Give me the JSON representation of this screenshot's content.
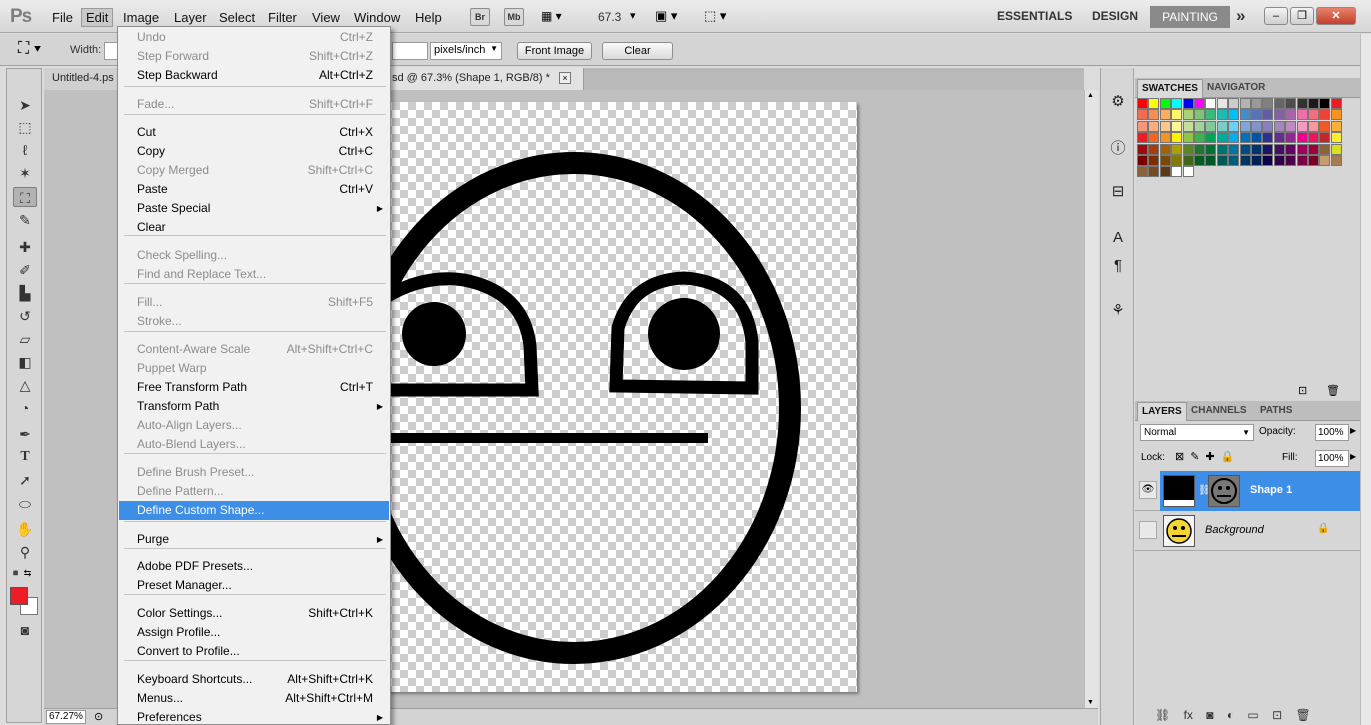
{
  "app": {
    "logo": "Ps"
  },
  "menubar": {
    "items": [
      "File",
      "Edit",
      "Image",
      "Layer",
      "Select",
      "Filter",
      "View",
      "Window",
      "Help"
    ],
    "bridge_btn": "Br",
    "minibridge_btn": "Mb",
    "zoom": "67.3",
    "workspaces": {
      "essentials": "ESSENTIALS",
      "design": "DESIGN",
      "painting": "PAINTING",
      "more": "»"
    }
  },
  "options": {
    "width_label": "Width:",
    "resolution_unit": "pixels/inch",
    "front_image": "Front Image",
    "clear": "Clear"
  },
  "tabs": {
    "tab1": "Untitled-4.ps",
    "tab2": "sd @ 67.3% (Shape 1, RGB/8) *",
    "close": "×"
  },
  "status": {
    "zoom": "67.27%"
  },
  "swatches_panel": {
    "tab_swatches": "SWATCHES",
    "tab_navigator": "NAVIGATOR",
    "colors": [
      "#ff0000",
      "#ffff00",
      "#00ff00",
      "#00ffff",
      "#0000ff",
      "#ff00ff",
      "#ffffff",
      "#e6e6e6",
      "#cccccc",
      "#b3b3b3",
      "#999999",
      "#808080",
      "#666666",
      "#4d4d4d",
      "#333333",
      "#1a1a1a",
      "#000000",
      "#ed1c24",
      "#f26c4f",
      "#f68e56",
      "#fbaf5d",
      "#fff568",
      "#acd373",
      "#7cc576",
      "#3cb878",
      "#1cbbb4",
      "#00bff3",
      "#448ccb",
      "#5574b9",
      "#605ca8",
      "#8560a8",
      "#a864a8",
      "#f06ea9",
      "#f26d7d",
      "#ef4136",
      "#f7941d",
      "#f7977a",
      "#f9ad81",
      "#fdc68a",
      "#fff79a",
      "#c4df9b",
      "#a3d39c",
      "#82ca9c",
      "#7accc8",
      "#6dcff6",
      "#7da7d9",
      "#8393ca",
      "#8781bd",
      "#a187be",
      "#bd8cbf",
      "#f49ac2",
      "#f6989d",
      "#f15a24",
      "#fbb03b",
      "#ed1c24",
      "#f26522",
      "#f7941d",
      "#fff200",
      "#8dc63f",
      "#39b54a",
      "#00a651",
      "#00a99d",
      "#00aeef",
      "#0072bc",
      "#0054a6",
      "#2e3192",
      "#662d91",
      "#92278f",
      "#ec008c",
      "#ed145b",
      "#c1272d",
      "#f9ed32",
      "#9e0b0f",
      "#a0410d",
      "#a36209",
      "#aba000",
      "#598527",
      "#1a7b30",
      "#007236",
      "#00746b",
      "#0076a3",
      "#004b80",
      "#003471",
      "#1b1464",
      "#440e62",
      "#630460",
      "#9e005d",
      "#9e0039",
      "#8c6239",
      "#d9e021",
      "#790000",
      "#7b2e00",
      "#7d4900",
      "#827b00",
      "#406618",
      "#005e20",
      "#005826",
      "#005952",
      "#005b7f",
      "#003663",
      "#002157",
      "#0d004c",
      "#32004b",
      "#4b0049",
      "#7b0046",
      "#7a0026",
      "#c69c6d",
      "#a67c52",
      "#8c6239",
      "#754c24",
      "#603913",
      "#ffffff",
      "#ffffff"
    ]
  },
  "layers_panel": {
    "tab_layers": "LAYERS",
    "tab_channels": "CHANNELS",
    "tab_paths": "PATHS",
    "blend_mode": "Normal",
    "opacity_label": "Opacity:",
    "opacity": "100%",
    "lock_label": "Lock:",
    "fill_label": "Fill:",
    "fill": "100%",
    "layers": [
      {
        "name": "Shape 1"
      },
      {
        "name": "Background"
      }
    ]
  },
  "edit_menu": {
    "items": [
      {
        "label": "Undo",
        "shortcut": "Ctrl+Z",
        "disabled": true
      },
      {
        "label": "Step Forward",
        "shortcut": "Shift+Ctrl+Z",
        "disabled": true
      },
      {
        "label": "Step Backward",
        "shortcut": "Alt+Ctrl+Z"
      },
      {
        "label": "Fade...",
        "shortcut": "Shift+Ctrl+F",
        "disabled": true
      },
      {
        "label": "Cut",
        "shortcut": "Ctrl+X"
      },
      {
        "label": "Copy",
        "shortcut": "Ctrl+C"
      },
      {
        "label": "Copy Merged",
        "shortcut": "Shift+Ctrl+C",
        "disabled": true
      },
      {
        "label": "Paste",
        "shortcut": "Ctrl+V"
      },
      {
        "label": "Paste Special",
        "submenu": true
      },
      {
        "label": "Clear"
      },
      {
        "label": "Check Spelling...",
        "disabled": true
      },
      {
        "label": "Find and Replace Text...",
        "disabled": true
      },
      {
        "label": "Fill...",
        "shortcut": "Shift+F5",
        "disabled": true
      },
      {
        "label": "Stroke...",
        "disabled": true
      },
      {
        "label": "Content-Aware Scale",
        "shortcut": "Alt+Shift+Ctrl+C",
        "disabled": true
      },
      {
        "label": "Puppet Warp",
        "disabled": true
      },
      {
        "label": "Free Transform Path",
        "shortcut": "Ctrl+T"
      },
      {
        "label": "Transform Path",
        "submenu": true
      },
      {
        "label": "Auto-Align Layers...",
        "disabled": true
      },
      {
        "label": "Auto-Blend Layers...",
        "disabled": true
      },
      {
        "label": "Define Brush Preset...",
        "disabled": true
      },
      {
        "label": "Define Pattern...",
        "disabled": true
      },
      {
        "label": "Define Custom Shape...",
        "highlighted": true
      },
      {
        "label": "Purge",
        "submenu": true
      },
      {
        "label": "Adobe PDF Presets..."
      },
      {
        "label": "Preset Manager..."
      },
      {
        "label": "Color Settings...",
        "shortcut": "Shift+Ctrl+K"
      },
      {
        "label": "Assign Profile..."
      },
      {
        "label": "Convert to Profile..."
      },
      {
        "label": "Keyboard Shortcuts...",
        "shortcut": "Alt+Shift+Ctrl+K"
      },
      {
        "label": "Menus...",
        "shortcut": "Alt+Shift+Ctrl+M"
      },
      {
        "label": "Preferences",
        "submenu": true
      }
    ]
  },
  "colors": {
    "foreground": "#ee1c24",
    "background": "#ffffff",
    "highlight": "#3d8ee6",
    "layer_selected": "#3d8ee6"
  }
}
